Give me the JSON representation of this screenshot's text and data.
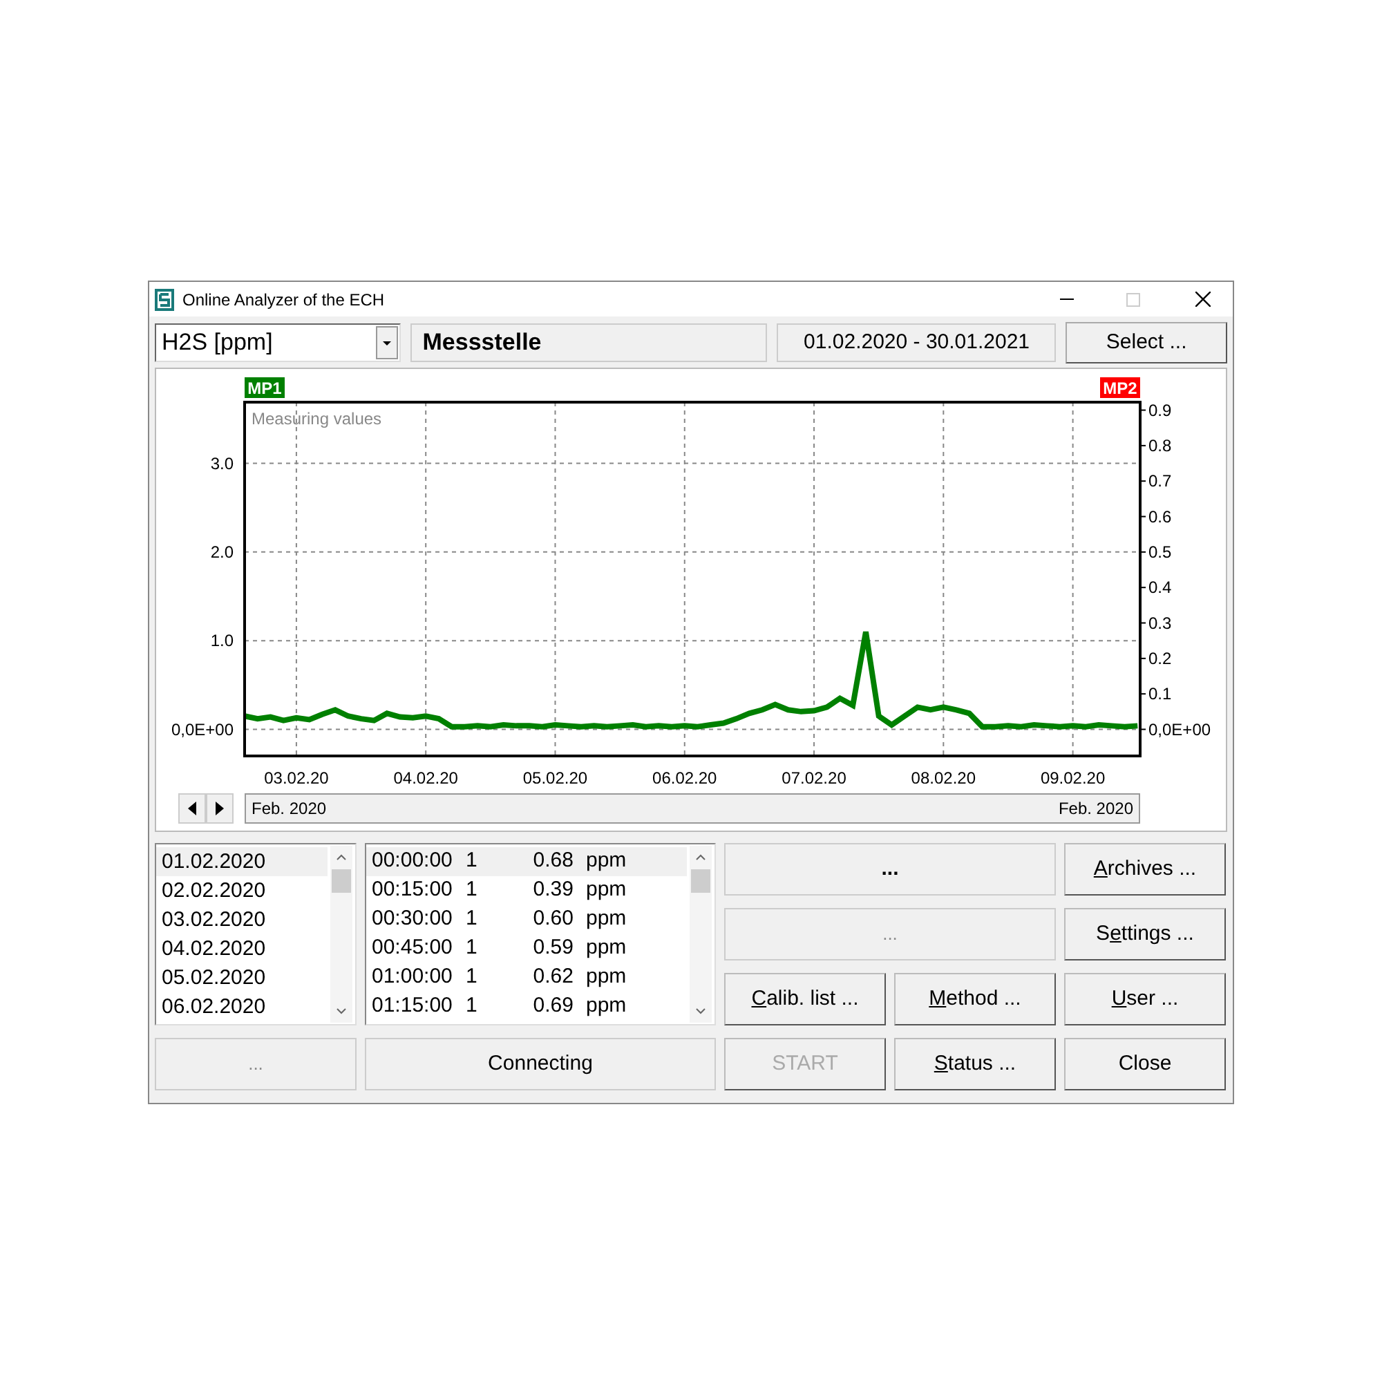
{
  "window": {
    "title": "Online Analyzer of the ECH"
  },
  "toolbar": {
    "component": "H2S [ppm]",
    "location": "Messstelle",
    "period": "01.02.2020 - 30.01.2021",
    "select_button": "Select ..."
  },
  "chart": {
    "y2_badge": "MP2",
    "chart_data": {
      "type": "line",
      "title": "Measuring values",
      "grid": true,
      "ylim": [
        -0.3,
        3.69
      ],
      "y2lim": [
        -0.075,
        0.9225
      ],
      "categories": [
        null,
        null,
        null,
        null,
        "03.02.20",
        null,
        null,
        null,
        null,
        null,
        null,
        null,
        null,
        null,
        "04.02.20",
        null,
        null,
        null,
        null,
        null,
        null,
        null,
        null,
        null,
        "05.02.20",
        null,
        null,
        null,
        null,
        null,
        null,
        null,
        null,
        null,
        "06.02.20",
        null,
        null,
        null,
        null,
        null,
        null,
        null,
        null,
        null,
        "07.02.20",
        null,
        null,
        null,
        null,
        null,
        null,
        null,
        null,
        null,
        "08.02.20",
        null,
        null,
        null,
        null,
        null,
        null,
        null,
        null,
        null,
        "09.02.20",
        null,
        null,
        null,
        null,
        null
      ],
      "yticks": [
        {
          "value": 0,
          "label": "0,0E+00"
        },
        {
          "value": 1,
          "label": "1.0"
        },
        {
          "value": 2,
          "label": "2.0"
        },
        {
          "value": 3,
          "label": "3.0"
        }
      ],
      "y2ticks": [
        {
          "value": 0,
          "label": "0,0E+00"
        },
        {
          "value": 0.1,
          "label": "0.1"
        },
        {
          "value": 0.2,
          "label": "0.2"
        },
        {
          "value": 0.3,
          "label": "0.3"
        },
        {
          "value": 0.4,
          "label": "0.4"
        },
        {
          "value": 0.5,
          "label": "0.5"
        },
        {
          "value": 0.6,
          "label": "0.6"
        },
        {
          "value": 0.7,
          "label": "0.7"
        },
        {
          "value": 0.8,
          "label": "0.8"
        },
        {
          "value": 0.9,
          "label": "0.9"
        }
      ],
      "series": [
        {
          "name": "MP1",
          "color": "#008000",
          "values": [
            0.15,
            0.12,
            0.14,
            0.1,
            0.13,
            0.11,
            0.17,
            0.22,
            0.15,
            0.12,
            0.1,
            0.18,
            0.14,
            0.13,
            0.15,
            0.12,
            0.03,
            0.03,
            0.04,
            0.03,
            0.05,
            0.04,
            0.04,
            0.03,
            0.05,
            0.04,
            0.03,
            0.04,
            0.03,
            0.04,
            0.05,
            0.03,
            0.04,
            0.03,
            0.04,
            0.03,
            0.05,
            0.07,
            0.12,
            0.18,
            0.22,
            0.28,
            0.22,
            0.2,
            0.21,
            0.25,
            0.35,
            0.27,
            1.1,
            0.15,
            0.05,
            0.15,
            0.25,
            0.22,
            0.25,
            0.22,
            0.18,
            0.03,
            0.03,
            0.04,
            0.03,
            0.05,
            0.04,
            0.03,
            0.04,
            0.03,
            0.05,
            0.04,
            0.03,
            0.04
          ]
        }
      ]
    },
    "scroll_labels": [
      "Feb. 2020",
      "Feb. 2020"
    ]
  },
  "days": [
    {
      "label": "01.02.2020",
      "selected": true
    },
    {
      "label": "02.02.2020",
      "selected": false
    },
    {
      "label": "03.02.2020",
      "selected": false
    },
    {
      "label": "04.02.2020",
      "selected": false
    },
    {
      "label": "05.02.2020",
      "selected": false
    },
    {
      "label": "06.02.2020",
      "selected": false
    }
  ],
  "readings": [
    {
      "time": "00:00:00",
      "channel": "1",
      "value": "0.68",
      "unit": "ppm",
      "selected": true
    },
    {
      "time": "00:15:00",
      "channel": "1",
      "value": "0.39",
      "unit": "ppm",
      "selected": false
    },
    {
      "time": "00:30:00",
      "channel": "1",
      "value": "0.60",
      "unit": "ppm",
      "selected": false
    },
    {
      "time": "00:45:00",
      "channel": "1",
      "value": "0.59",
      "unit": "ppm",
      "selected": false
    },
    {
      "time": "01:00:00",
      "channel": "1",
      "value": "0.62",
      "unit": "ppm",
      "selected": false
    },
    {
      "time": "01:15:00",
      "channel": "1",
      "value": "0.69",
      "unit": "ppm",
      "selected": false
    }
  ],
  "status_fields": {
    "day_status": "...",
    "connection": "Connecting",
    "info_bold": "...",
    "info": "..."
  },
  "buttons": [
    {
      "access_key": "A",
      "label_rest": "rchives ...",
      "disabled": false
    },
    {
      "label_start": "S",
      "access_key": "e",
      "label_rest": "ttings ...",
      "disabled": false
    },
    {
      "access_key": "C",
      "label_rest": "alib. list ...",
      "disabled": false
    },
    {
      "access_key": "M",
      "label_rest": "ethod ...",
      "disabled": false
    },
    {
      "access_key": "U",
      "label_rest": "ser ...",
      "disabled": false
    },
    {
      "label_rest": "START",
      "disabled": true
    },
    {
      "access_key": "S",
      "label_rest": "tatus ...",
      "disabled": false
    },
    {
      "label_rest": "Close",
      "disabled": false
    }
  ]
}
